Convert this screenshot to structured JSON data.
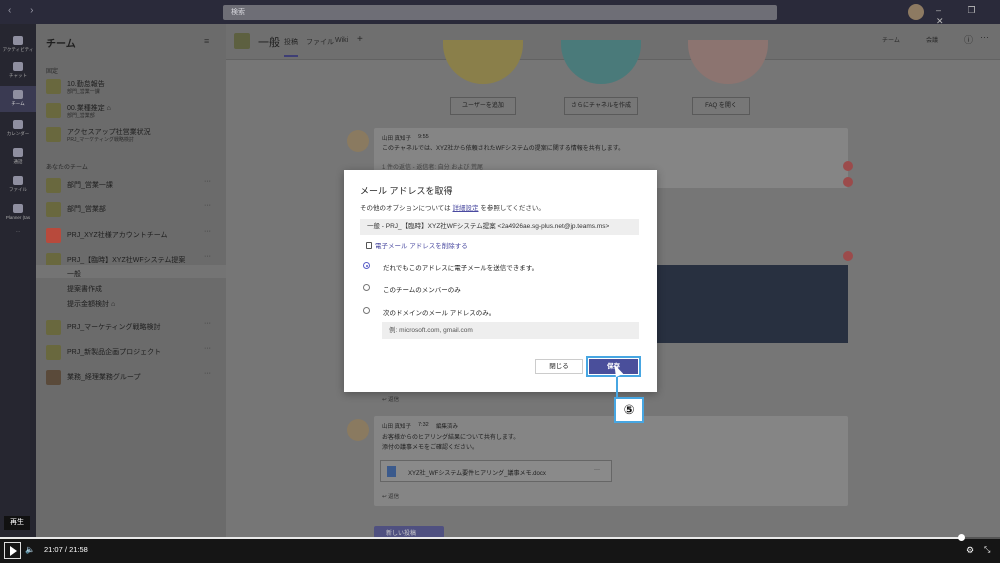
{
  "topbar": {
    "search_placeholder": "検索",
    "nav_arrows": "‹ ›",
    "window_controls": "– ❐ ✕"
  },
  "rail": [
    {
      "label": "アクティビティ",
      "icon": "bell-icon"
    },
    {
      "label": "チャット",
      "icon": "chat-icon"
    },
    {
      "label": "チーム",
      "icon": "teams-icon",
      "active": true
    },
    {
      "label": "カレンダー",
      "icon": "calendar-icon"
    },
    {
      "label": "通話",
      "icon": "phone-icon"
    },
    {
      "label": "ファイル",
      "icon": "file-icon"
    },
    {
      "label": "Planner (tas",
      "icon": "planner-icon"
    },
    {
      "label": "...",
      "icon": "more-icon"
    }
  ],
  "sidebar": {
    "title": "チーム",
    "filter_icon": "≡",
    "section_pinned": "固定",
    "section_your": "あなたのチーム",
    "teams": [
      {
        "name": "10.勤怠報告",
        "sub": "部門_営業一課"
      },
      {
        "name": "00.業種推定 ⌂",
        "sub": "部門_営業部"
      },
      {
        "name": "アクセスアップ社営業状況",
        "sub": "PRJ_マーケティング戦略検討"
      },
      {
        "name": "部門_営業一課",
        "sub": ""
      },
      {
        "name": "部門_営業部",
        "sub": ""
      },
      {
        "name": "PRJ_XYZ社様アカウントチーム",
        "sub": ""
      },
      {
        "name": "PRJ_【臨時】XYZ社WFシステム提案",
        "sub": ""
      },
      {
        "name": "PRJ_マーケティング戦略検討",
        "sub": ""
      },
      {
        "name": "PRJ_新製品企画プロジェクト",
        "sub": ""
      },
      {
        "name": "業務_経理業務グループ",
        "sub": ""
      }
    ],
    "more": "···",
    "channels": [
      "一般",
      "提案書作成",
      "提示金額検討 ⌂"
    ],
    "bottom": "チームに参加、またはチームを作成"
  },
  "header": {
    "channel": "一般",
    "tabs": [
      "投稿",
      "ファイル",
      "Wiki",
      "+"
    ],
    "team_button": "チーム",
    "meeting_button": "会議",
    "info_icon": "ⓘ",
    "more": "···"
  },
  "welcome": {
    "buttons": [
      "ユーザーを追加",
      "さらにチャネルを作成",
      "FAQ を開く"
    ]
  },
  "messages": [
    {
      "author": "山田 真知子",
      "time": "9:55",
      "text": "このチャネルでは、XYZ社から依頼されたWFシステムの提案に関する情報を共有します。",
      "extra": "1 件の返信 - 返信者: 自分 および 荒尾"
    },
    {
      "author": "山田 真知子",
      "time": "7:32",
      "edited": "編集済み",
      "line1": "お客様からのヒアリング結果について共有します。",
      "line2": "添付の議事メモをご確認ください。",
      "attachment": "XYZ社_WFシステム要件ヒアリング_議事メモ.docx",
      "reply": "↩ 返信"
    }
  ],
  "reply_label": "↩ 返信",
  "new_conversation": "新しい投稿",
  "modal": {
    "title": "メール アドレスを取得",
    "subtitle_pre": "その他のオプションについては",
    "subtitle_link": "詳細設定",
    "subtitle_post": "を参照してください。",
    "address": "一般 - PRJ_【臨時】XYZ社WFシステム提案 <2a4926ae.sg-plus.net@jp.teams.ms>",
    "remove_link": "電子メール アドレスを削除する",
    "options": [
      "だれでもこのアドレスに電子メールを送信できます。",
      "このチームのメンバーのみ",
      "次のドメインのメール アドレスのみ。"
    ],
    "selected_index": 0,
    "domain_placeholder": "例: microsoft.com, gmail.com",
    "close_button": "閉じる",
    "save_button": "保存"
  },
  "callout": {
    "number": "⑤",
    "color": "#47a6e2"
  },
  "player": {
    "tooltip": "再生",
    "current_time": "21:07",
    "total_time": "21:58",
    "time_separator": "/",
    "progress": 0.961,
    "volume_icon": "🔈",
    "settings_icon": "⚙",
    "fullscreen_icon": "⤡"
  },
  "colors": {
    "accent": "#5b5fc7",
    "save_button": "#4a4f9b",
    "callout": "#47a6e2"
  }
}
